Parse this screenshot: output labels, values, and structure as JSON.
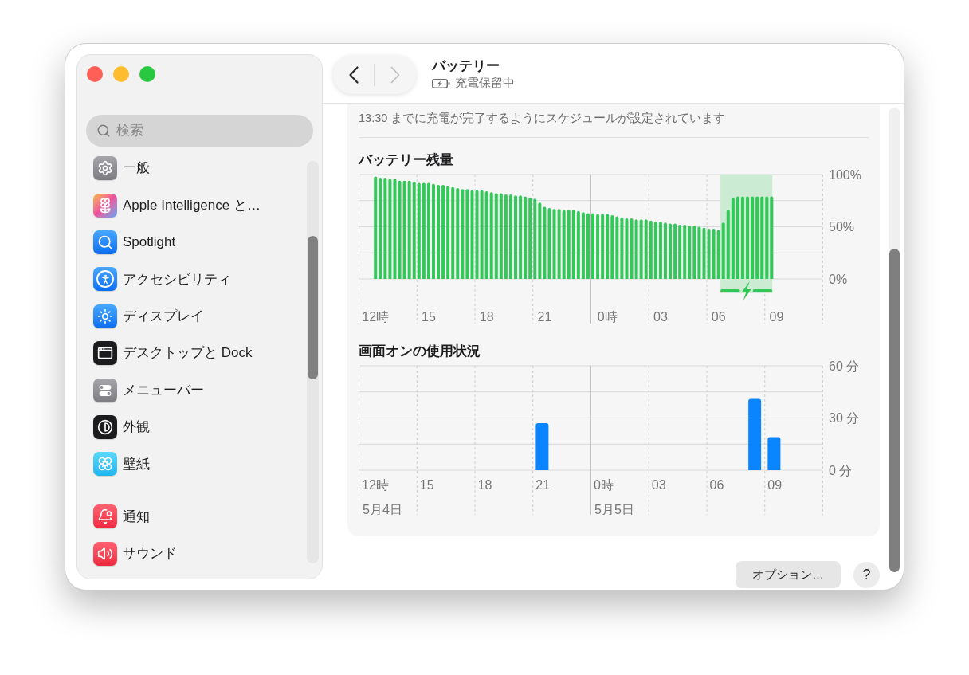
{
  "sidebar": {
    "search": {
      "placeholder": "検索"
    },
    "groups": [
      [
        {
          "label": "一般",
          "selected": false
        },
        {
          "label": "Apple Intelligence と…",
          "selected": false
        },
        {
          "label": "Spotlight",
          "selected": false
        },
        {
          "label": "アクセシビリティ",
          "selected": false
        },
        {
          "label": "ディスプレイ",
          "selected": false
        },
        {
          "label": "デスクトップと Dock",
          "selected": false
        },
        {
          "label": "メニューバー",
          "selected": false
        },
        {
          "label": "外観",
          "selected": false
        },
        {
          "label": "壁紙",
          "selected": false
        }
      ],
      [
        {
          "label": "通知",
          "selected": false
        },
        {
          "label": "サウンド",
          "selected": false
        }
      ]
    ]
  },
  "header": {
    "nav": [
      {
        "kind": "back",
        "disabled": false
      },
      {
        "kind": "forward",
        "disabled": true
      }
    ],
    "title": "バッテリー",
    "status": "充電保留中"
  },
  "content": {
    "schedule_note": "13:30 までに充電が完了するようにスケジュールが設定されています",
    "battery_level": {
      "chart_data": {
        "type": "bar",
        "title": "バッテリー残量",
        "categories": [
          null,
          null,
          null,
          "12時",
          null,
          null,
          null,
          null,
          null,
          null,
          null,
          null,
          null,
          null,
          "15",
          null,
          null,
          null,
          null,
          null,
          null,
          null,
          null,
          null,
          null,
          null,
          "18",
          null,
          null,
          null,
          null,
          null,
          null,
          null,
          null,
          null,
          null,
          null,
          "21",
          null,
          null,
          null,
          null,
          null,
          null,
          null,
          null,
          null,
          null,
          null,
          null,
          "0時",
          null,
          null,
          null,
          null,
          null,
          null,
          null,
          null,
          null,
          null,
          "03",
          null,
          null,
          null,
          null,
          null,
          null,
          null,
          null,
          null,
          null,
          null,
          "06",
          null,
          null,
          null,
          null,
          null,
          null,
          null,
          null,
          null,
          null,
          null,
          "09",
          null,
          null,
          null,
          null,
          null,
          null,
          null,
          null,
          null
        ],
        "values": [
          null,
          null,
          null,
          98,
          97,
          97,
          96,
          96,
          94,
          94,
          94,
          93,
          92,
          92,
          92,
          91,
          90,
          90,
          89,
          88,
          87,
          86,
          86,
          85,
          85,
          85,
          84,
          83,
          82,
          82,
          81,
          81,
          80,
          80,
          79,
          78,
          77,
          73,
          69,
          68,
          67,
          67,
          66,
          66,
          66,
          65,
          64,
          63,
          63,
          62,
          62,
          62,
          61,
          60,
          59,
          58,
          58,
          57,
          57,
          57,
          56,
          55,
          55,
          54,
          53,
          53,
          52,
          52,
          51,
          51,
          50,
          49,
          48,
          48,
          47,
          54,
          66,
          78,
          79,
          79,
          79,
          79,
          79,
          79,
          79,
          79,
          null,
          null,
          null,
          null,
          null,
          null,
          null,
          null,
          null,
          null
        ],
        "ylim": [
          0,
          100
        ],
        "yticks": [
          {
            "value": 0,
            "label": "0%"
          },
          {
            "value": 50,
            "label": "50%"
          },
          {
            "value": 100,
            "label": "100%"
          }
        ]
      }
    },
    "screen_usage": {
      "chart_data": {
        "type": "bar",
        "title": "画面オンの使用状況",
        "categories": [
          "12時",
          null,
          null,
          "15",
          null,
          null,
          "18",
          null,
          null,
          "21",
          null,
          null,
          "0時",
          null,
          null,
          "03",
          null,
          null,
          "06",
          null,
          null,
          "09",
          null,
          null
        ],
        "values": [
          0,
          0,
          0,
          0,
          0,
          0,
          0,
          0,
          0,
          27,
          0,
          0,
          0,
          0,
          0,
          0,
          0,
          0,
          0,
          0,
          41,
          19,
          0,
          0
        ],
        "ylim": [
          0,
          60
        ],
        "yticks": [
          {
            "value": 0,
            "label": "0 分"
          },
          {
            "value": 30,
            "label": "30 分"
          },
          {
            "value": 60,
            "label": "60 分"
          }
        ]
      },
      "dates": [
        "5月4日",
        "5月5日"
      ]
    }
  },
  "buttons": [
    {
      "kind": "options",
      "label": "オプション…"
    },
    {
      "kind": "help",
      "label": "?"
    }
  ]
}
